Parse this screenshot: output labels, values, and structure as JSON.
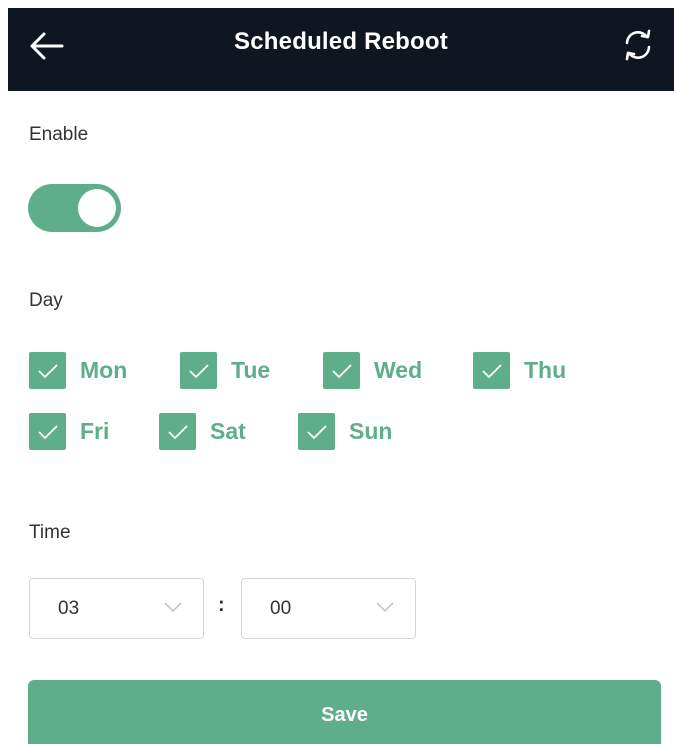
{
  "header": {
    "title": "Scheduled Reboot",
    "back_icon": "arrow-left-icon",
    "refresh_icon": "refresh-icon"
  },
  "enable": {
    "label": "Enable",
    "state": "on"
  },
  "day": {
    "label": "Day",
    "days": [
      {
        "label": "Mon",
        "checked": true
      },
      {
        "label": "Tue",
        "checked": true
      },
      {
        "label": "Wed",
        "checked": true
      },
      {
        "label": "Thu",
        "checked": true
      },
      {
        "label": "Fri",
        "checked": true
      },
      {
        "label": "Sat",
        "checked": true
      },
      {
        "label": "Sun",
        "checked": true
      }
    ]
  },
  "time": {
    "label": "Time",
    "hour": "03",
    "separator": ":",
    "minute": "00"
  },
  "save_label": "Save",
  "colors": {
    "accent": "#5fae8a",
    "header_bg": "#0e1721",
    "text": "#333333"
  }
}
